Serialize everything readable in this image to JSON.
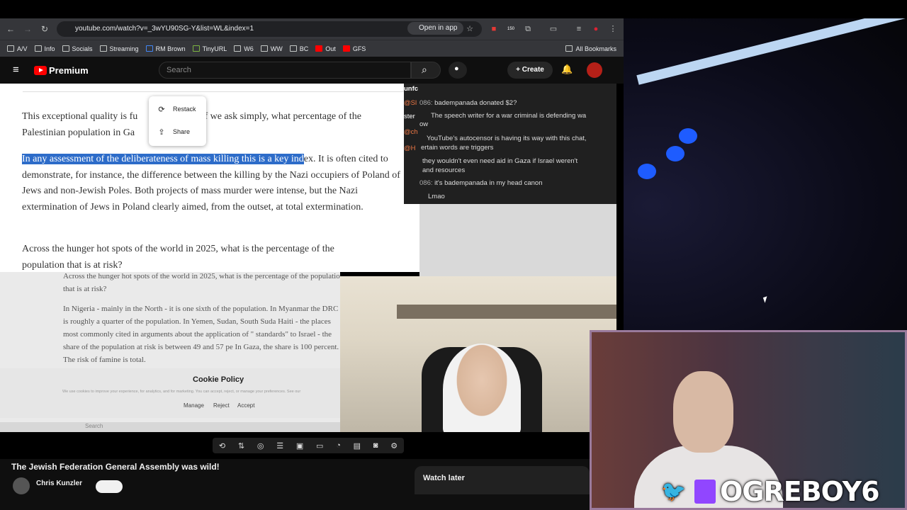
{
  "browser": {
    "url": "youtube.com/watch?v=_3wYU90SG-Y&list=WL&index=1",
    "open_in_app": "Open in app",
    "ext_badge": "150",
    "bookmarks": [
      "A/V",
      "Info",
      "Socials",
      "Streaming",
      "RM Brown",
      "TinyURL",
      "W6",
      "WW",
      "BC",
      "Out",
      "GFS"
    ],
    "all_bookmarks": "All Bookmarks"
  },
  "youtube": {
    "logo_text": "Premium",
    "search_placeholder": "Search",
    "create_label": "Create"
  },
  "article": {
    "p1_a": "This exceptional quality is fu",
    "p1_b": "sized if we ask simply, what percentage of the",
    "p1_c": "Palestinian population in Ga",
    "p2_highlight": "In any assessment of the deliberateness of mass killing this is a key ind",
    "p2_rest": "ex. It is often cited to demonstrate, for instance, the difference between the killing by the Nazi occupiers of Poland of Jews and non-Jewish Poles. Both projects of mass murder were intense, but the Nazi extermination of Jews in Poland clearly aimed, from the outset, at total extermination.",
    "p3": "Across the hunger hot spots of the world in 2025, what is the percentage of the population that is at risk?",
    "popup_restack": "Restack",
    "popup_share": "Share"
  },
  "chat": {
    "header": "unfc",
    "lines": [
      {
        "user": "086:",
        "text": "badempanada donated $2?"
      },
      {
        "user": "",
        "text": "The speech writer for a war criminal is defending wa"
      },
      {
        "user": "",
        "text": "ow"
      },
      {
        "user": "",
        "text": "YouTube's autocensor is having its way with this chat,"
      },
      {
        "user": "",
        "text": "ertain words are triggers"
      },
      {
        "user": "",
        "text": "they wouldn't even need aid in Gaza if Israel weren't"
      },
      {
        "user": "",
        "text": "and resources"
      },
      {
        "user": "086:",
        "text": "it's badempanada in my head canon"
      },
      {
        "user": "",
        "text": "Lmao"
      }
    ],
    "side_tags": [
      "@Sl",
      "ster",
      "@ch",
      "@H"
    ]
  },
  "screenshot": {
    "p1": "Across the hunger hot spots of the world in 2025, what is the percentage of the population that is at risk?",
    "p2": "In Nigeria - mainly in the North - it is one sixth of the population. In Myanmar the DRC it is roughly a quarter of the population. In Yemen, Sudan, South Suda Haiti - the places most commonly cited in arguments about the application of \" standards\" to Israel - the share of the population at risk is between 49 and 57 pe In Gaza, the share is 100 percent. The risk of famine is total.",
    "cookie_title": "Cookie Policy",
    "cookie_sub": "We use cookies to improve your experience, for analytics, and for marketing. You can accept, reject, or manage your preferences. See our",
    "cookie_manage": "Manage",
    "cookie_reject": "Reject",
    "cookie_accept": "Accept",
    "taskbar_search": "Search"
  },
  "video": {
    "title": "The Jewish Federation General Assembly was wild!",
    "channel": "Chris Kunzler",
    "watch_later": "Watch later"
  },
  "overlay": {
    "brand": "OGREBOY6"
  },
  "colors": {
    "highlight": "#2d6cc9",
    "yt_red": "#ff0000",
    "twitch": "#9146ff"
  }
}
